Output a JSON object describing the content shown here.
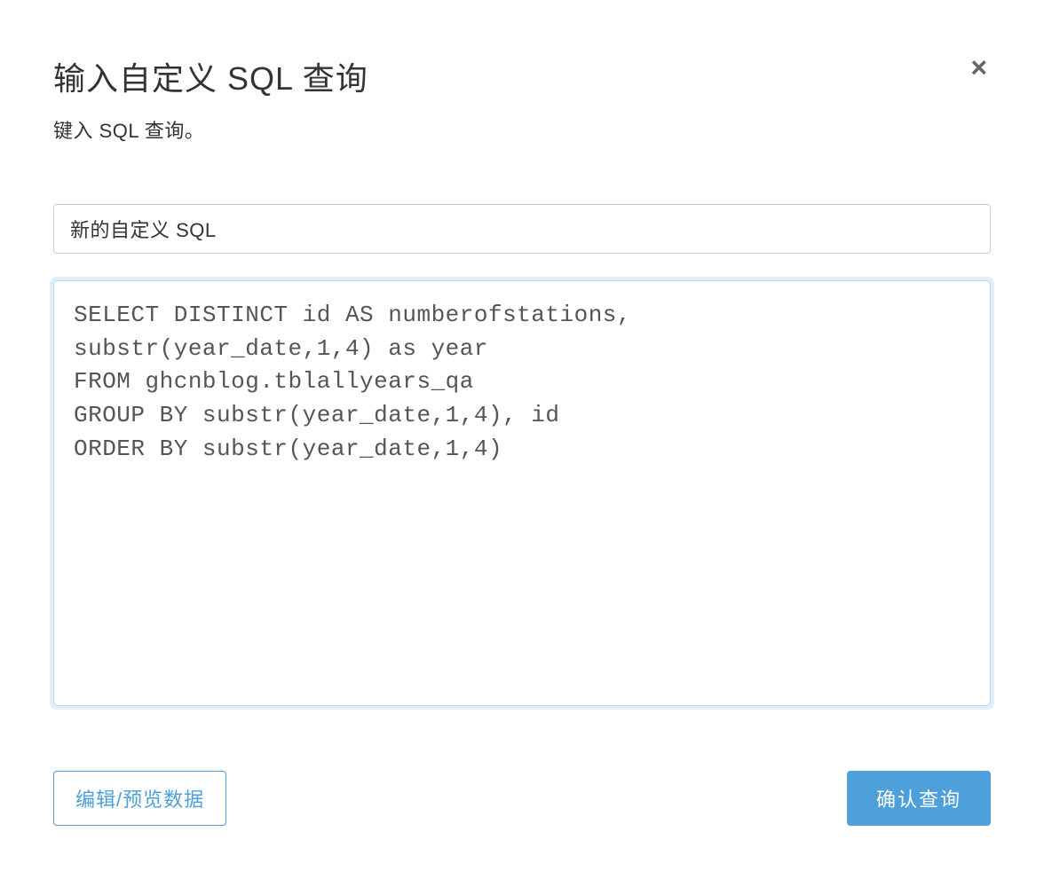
{
  "modal": {
    "title": "输入自定义 SQL 查询",
    "subtitle": "键入 SQL 查询。",
    "close_label": "×"
  },
  "form": {
    "name_value": "新的自定义 SQL",
    "sql_value": "SELECT DISTINCT id AS numberofstations,\nsubstr(year_date,1,4) as year\nFROM ghcnblog.tblallyears_qa\nGROUP BY substr(year_date,1,4), id\nORDER BY substr(year_date,1,4)"
  },
  "footer": {
    "edit_preview_label": "编辑/预览数据",
    "confirm_label": "确认查询"
  }
}
